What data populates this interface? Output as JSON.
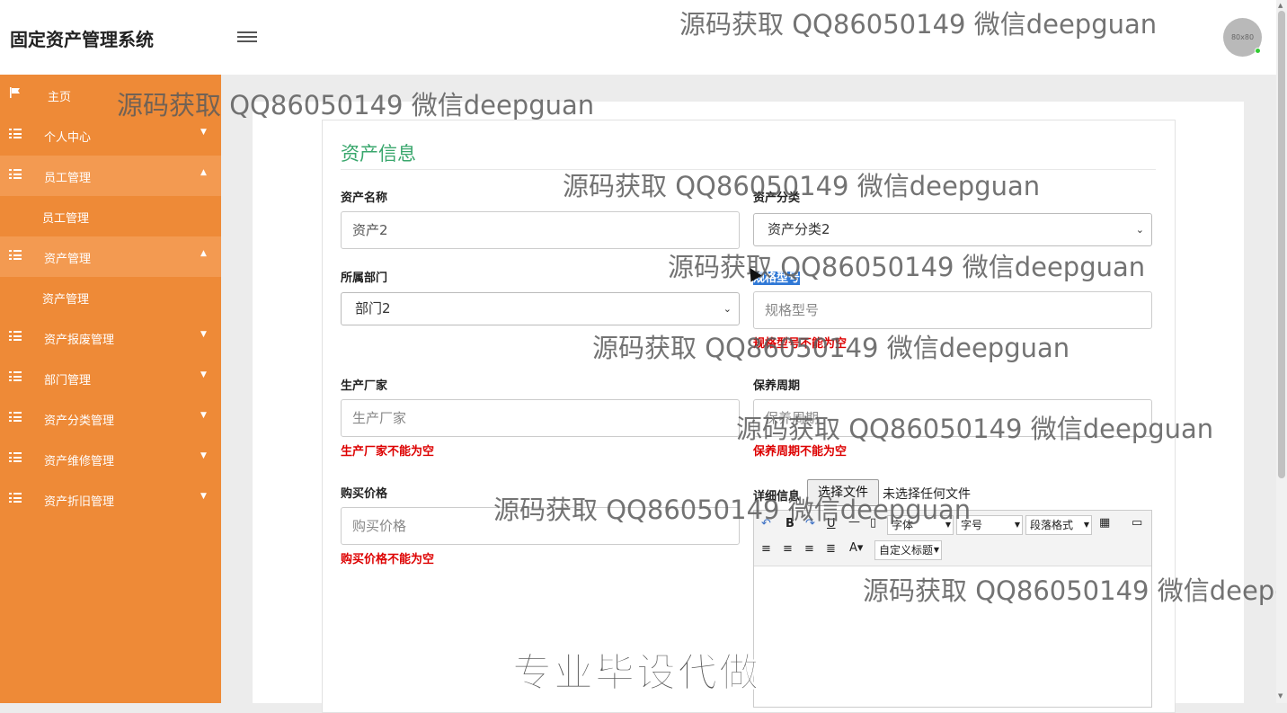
{
  "app": {
    "title": "固定资产管理系统",
    "avatar_text": "80x80"
  },
  "watermark": "源码获取 QQ86050149 微信deepguan",
  "promo": "专业毕设代做",
  "sidebar": {
    "items": [
      {
        "label": "主页"
      },
      {
        "label": "个人中心"
      },
      {
        "label": "员工管理"
      },
      {
        "label": "员工管理"
      },
      {
        "label": "资产管理"
      },
      {
        "label": "资产管理"
      },
      {
        "label": "资产报废管理"
      },
      {
        "label": "部门管理"
      },
      {
        "label": "资产分类管理"
      },
      {
        "label": "资产维修管理"
      },
      {
        "label": "资产折旧管理"
      }
    ]
  },
  "form": {
    "title": "资产信息",
    "asset_name": {
      "label": "资产名称",
      "value": "资产2"
    },
    "asset_category": {
      "label": "资产分类",
      "value": "资产分类2"
    },
    "department": {
      "label": "所属部门",
      "value": "部门2"
    },
    "model": {
      "label": "规格型号",
      "placeholder": "规格型号",
      "error": "规格型号不能为空"
    },
    "manufacturer": {
      "label": "生产厂家",
      "placeholder": "生产厂家",
      "error": "生产厂家不能为空"
    },
    "maintenance": {
      "label": "保养周期",
      "placeholder": "保养周期",
      "error": "保养周期不能为空"
    },
    "price": {
      "label": "购买价格",
      "placeholder": "购买价格",
      "error": "购买价格不能为空"
    },
    "detail": {
      "label": "详细信息",
      "file_button": "选择文件",
      "file_status": "未选择任何文件"
    }
  },
  "editor_toolbar": {
    "font": "字体",
    "size": "字号",
    "paragraph": "段落格式",
    "custom_title": "自定义标题"
  },
  "colors": {
    "sidebar": "#ee8a37",
    "accent": "#3aa76d",
    "error": "#dd0000"
  }
}
